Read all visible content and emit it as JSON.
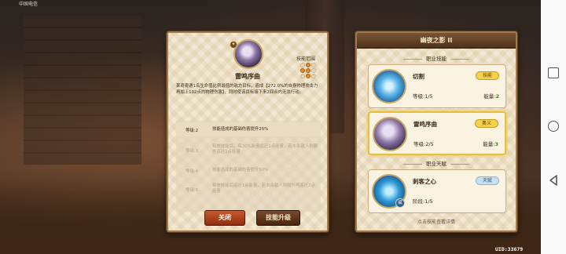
{
  "statusbar": {
    "carrier": "中国电信"
  },
  "detail": {
    "skill_name": "雷鸣序曲",
    "range_label": "技能范围",
    "range_cells": [
      0,
      1,
      0,
      1,
      1,
      0,
      0,
      1,
      0
    ],
    "description": "莱奇奇遇1名生命值比例最低的敌方目标，造成【272.0%的自身物理攻击力再加上102点的物理伤害】，同时使该目标接下来2回合内无法行动。",
    "levels": [
      {
        "label": "等级:2",
        "text": "技能造成的基础伤害提升25%",
        "current": true
      },
      {
        "label": "等级:3",
        "text": "释放技能后，每30%能量返还1点能量，若击杀敌人则额外返还1点能量",
        "current": false
      },
      {
        "label": "等级:4",
        "text": "技能造成的基础伤害提升50%",
        "current": false
      },
      {
        "label": "等级:5",
        "text": "释放技能后返还1点能量，若击杀敌人则额外再返还2点能量",
        "current": false
      }
    ],
    "close_button": "关闭",
    "upgrade_button": "技能升级"
  },
  "list": {
    "title": "幽夜之影 II",
    "section_skills": "职业技能",
    "section_talent": "职业天赋",
    "cards": [
      {
        "name": "切割",
        "tag": "技能",
        "tag_style": "yellow",
        "level_label": "等级:",
        "level": "1/5",
        "energy_label": "能量:",
        "energy": "2",
        "icon": "cut-skill-icon"
      },
      {
        "name": "雷鸣序曲",
        "tag": "奥义",
        "tag_style": "yellow",
        "level_label": "等级:",
        "level": "2/5",
        "energy_label": "能量:",
        "energy": "3",
        "icon": "thunder-song-skill-icon"
      },
      {
        "name": "刺客之心",
        "tag": "天赋",
        "tag_style": "blue",
        "level_label": "阶段:",
        "level": "1/5",
        "icon": "assassin-heart-talent-icon",
        "badge": "赋"
      }
    ],
    "hint": "点击技能查看详情"
  },
  "uid": "UID:33679"
}
